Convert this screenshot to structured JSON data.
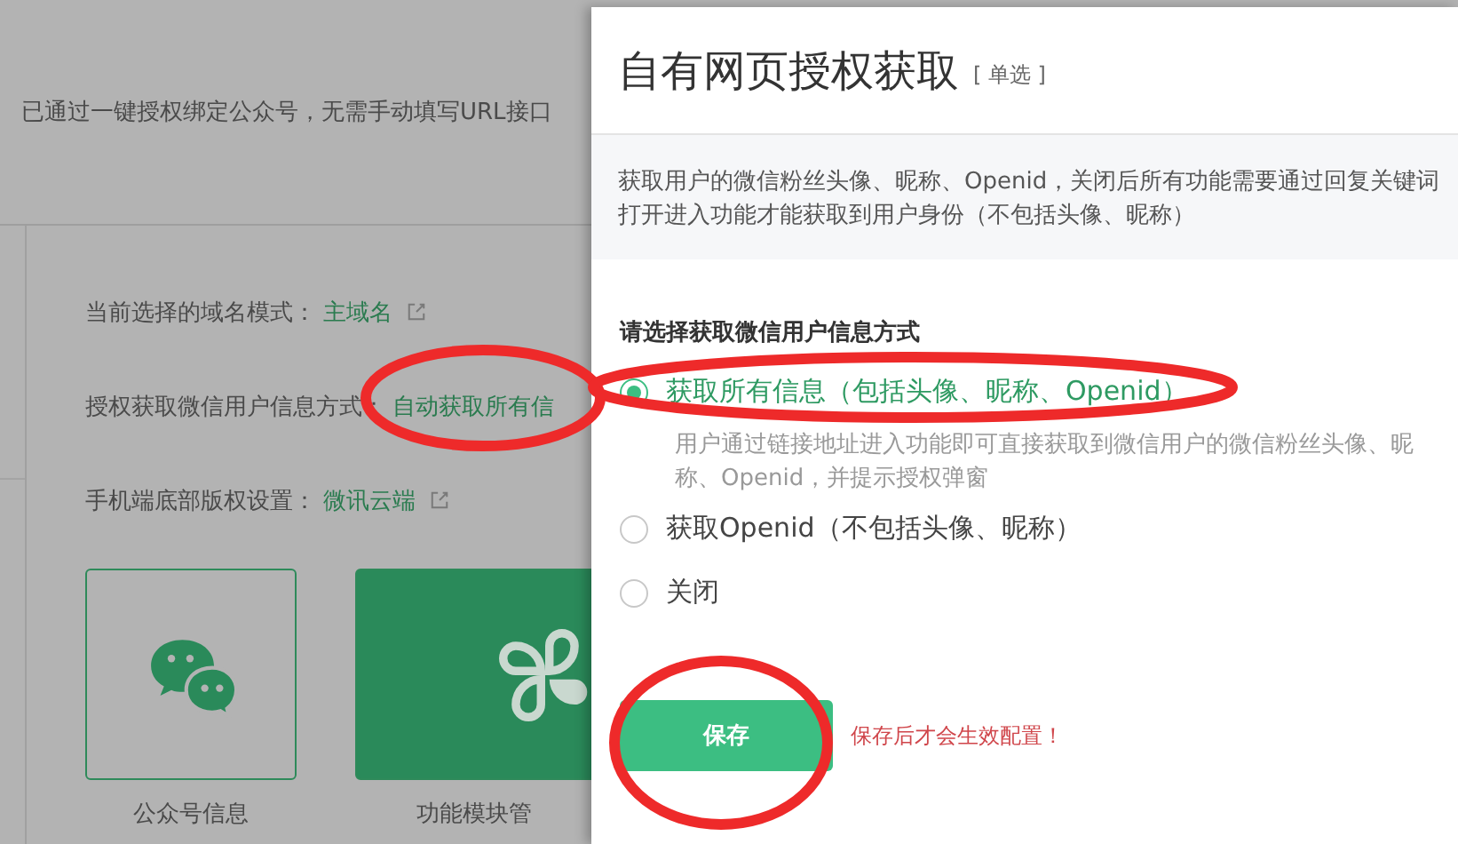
{
  "background_page": {
    "notice": "已通过一键授权绑定公众号，无需手动填写URL接口",
    "settings": [
      {
        "label": "当前选择的域名模式：",
        "value": "主域名",
        "edit_icon": true
      },
      {
        "label": "授权获取微信用户信息方式：",
        "value": "自动获取所有信",
        "edit_icon": false
      },
      {
        "label": "手机端底部版权设置：",
        "value": "微讯云端",
        "edit_icon": true
      }
    ],
    "modules": [
      {
        "kind": "chat",
        "label": "公众号信息",
        "selected": false
      },
      {
        "kind": "clover",
        "label": "功能模块管",
        "selected": true
      }
    ]
  },
  "dialog": {
    "title": "自有网页授权获取",
    "title_tag": "[ 单选 ]",
    "description": "获取用户的微信粉丝头像、昵称、Openid，关闭后所有功能需要通过回复关键词打开进入功能才能获取到用户身份（不包括头像、昵称）",
    "question": "请选择获取微信用户信息方式",
    "options": [
      {
        "label": "获取所有信息（包括头像、昵称、Openid）",
        "selected": true,
        "hint": "用户通过链接地址进入功能即可直接获取到微信用户的微信粉丝头像、昵称、Openid，并提示授权弹窗"
      },
      {
        "label": "获取Openid（不包括头像、昵称）",
        "selected": false
      },
      {
        "label": "关闭",
        "selected": false
      }
    ],
    "save_button": "保存",
    "save_note": "保存后才会生效配置！"
  }
}
